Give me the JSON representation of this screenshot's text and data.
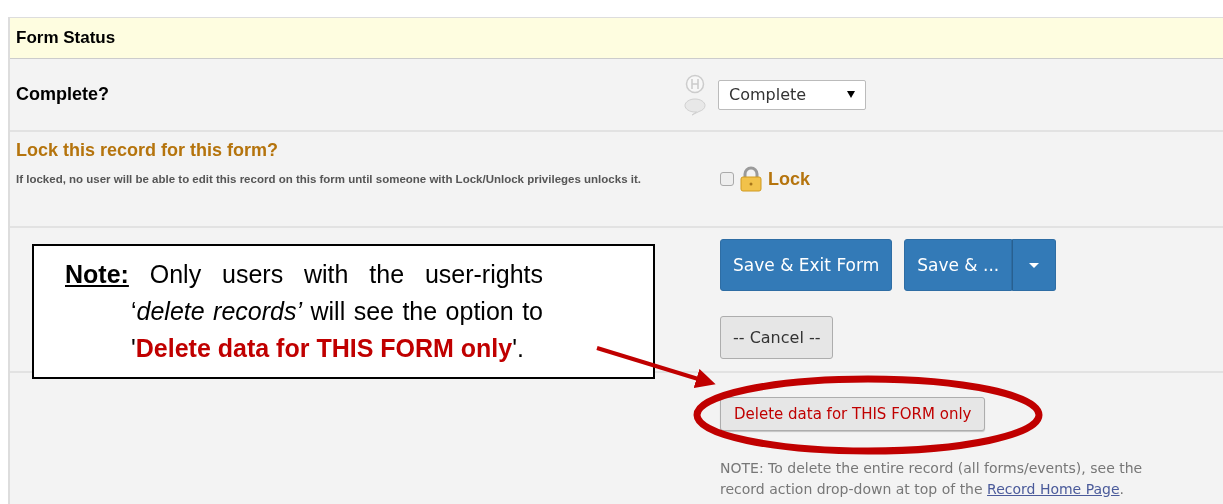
{
  "section_header": "Form Status",
  "complete_field": {
    "label": "Complete?",
    "value": "Complete"
  },
  "lock_field": {
    "label": "Lock this record for this form?",
    "description": "If locked, no user will be able to edit this record on this form until someone with Lock/Unlock privileges unlocks it.",
    "checked": false,
    "option_label": "Lock"
  },
  "buttons": [
    {
      "label": "Save & Exit Form",
      "kind": "primary"
    },
    {
      "label": "Save & ...",
      "kind": "split"
    },
    {
      "label": "-- Cancel --",
      "kind": "default"
    }
  ],
  "delete_button": {
    "label": "Delete data for THIS FORM only"
  },
  "delete_note": {
    "text": "NOTE: To delete the entire record (all forms/events), see the record action drop-down at top of the",
    "link": "Record Home Page",
    "end": "."
  },
  "callout": {
    "text": "**Note:** Only users with the user-rights ‘*delete records’* will see the option to '**Delete data for THIS FORM only**'."
  }
}
